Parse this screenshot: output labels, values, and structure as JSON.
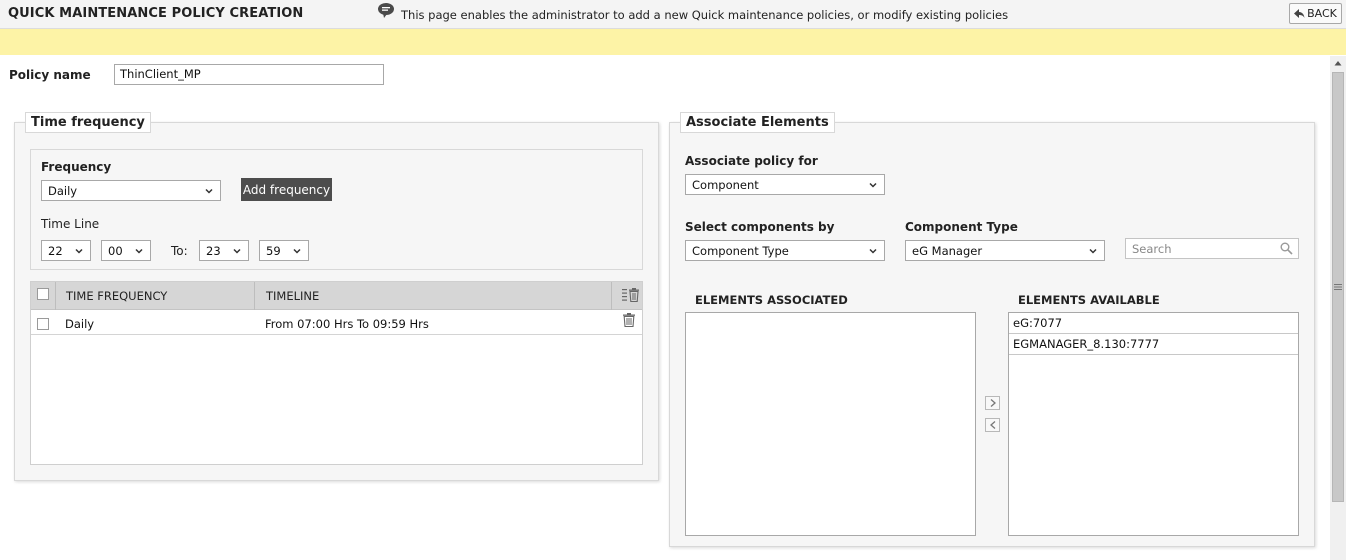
{
  "header": {
    "title": "QUICK MAINTENANCE POLICY CREATION",
    "back_label": "BACK"
  },
  "banner": {
    "text": "This page enables the administrator to add a new Quick maintenance policies, or modify existing policies"
  },
  "policy": {
    "label": "Policy name",
    "value": "ThinClient_MP"
  },
  "time_frequency": {
    "title": "Time frequency",
    "frequency_label": "Frequency",
    "frequency_value": "Daily",
    "add_button": "Add frequency",
    "timeline_label": "Time Line",
    "start_hour": "22",
    "start_minute": "00",
    "to_label": "To:",
    "end_hour": "23",
    "end_minute": "59",
    "table": {
      "headers": [
        "TIME FREQUENCY",
        "TIMELINE"
      ],
      "rows": [
        {
          "frequency": "Daily",
          "timeline": "From 07:00 Hrs To 09:59 Hrs"
        }
      ]
    }
  },
  "associate": {
    "title": "Associate Elements",
    "policy_for_label": "Associate policy for",
    "policy_for_value": "Component",
    "select_by_label": "Select components by",
    "select_by_value": "Component Type",
    "component_type_label": "Component Type",
    "component_type_value": "eG Manager",
    "search_placeholder": "Search",
    "associated_label": "ELEMENTS ASSOCIATED",
    "available_label": "ELEMENTS AVAILABLE",
    "available_items": [
      "eG:7077",
      "EGMANAGER_8.130:7777"
    ]
  },
  "colors": {
    "banner": "#fdf3a6",
    "dark_button": "#4d4d4d",
    "table_header": "#d6d6d6"
  }
}
